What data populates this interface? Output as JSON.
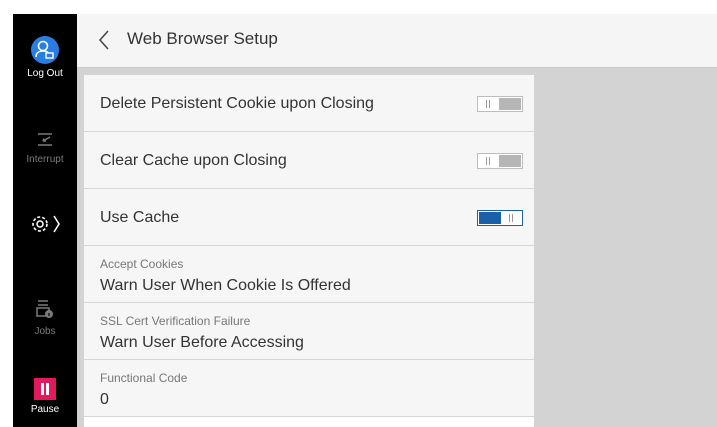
{
  "sidebar": {
    "logout_label": "Log Out",
    "interrupt_label": "Interrupt",
    "jobs_label": "Jobs",
    "pause_label": "Pause",
    "accent_color": "#2a7de1",
    "pause_color": "#e3195c"
  },
  "header": {
    "title": "Web Browser Setup"
  },
  "settings": [
    {
      "title": "Delete Persistent Cookie upon Closing",
      "toggle": "off"
    },
    {
      "title": "Clear Cache upon Closing",
      "toggle": "off"
    },
    {
      "title": "Use Cache",
      "toggle": "on"
    },
    {
      "label": "Accept Cookies",
      "value": "Warn User When Cookie Is Offered"
    },
    {
      "label": "SSL Cert Verification Failure",
      "value": "Warn User Before Accessing"
    },
    {
      "label": "Functional Code",
      "value": "0"
    }
  ]
}
